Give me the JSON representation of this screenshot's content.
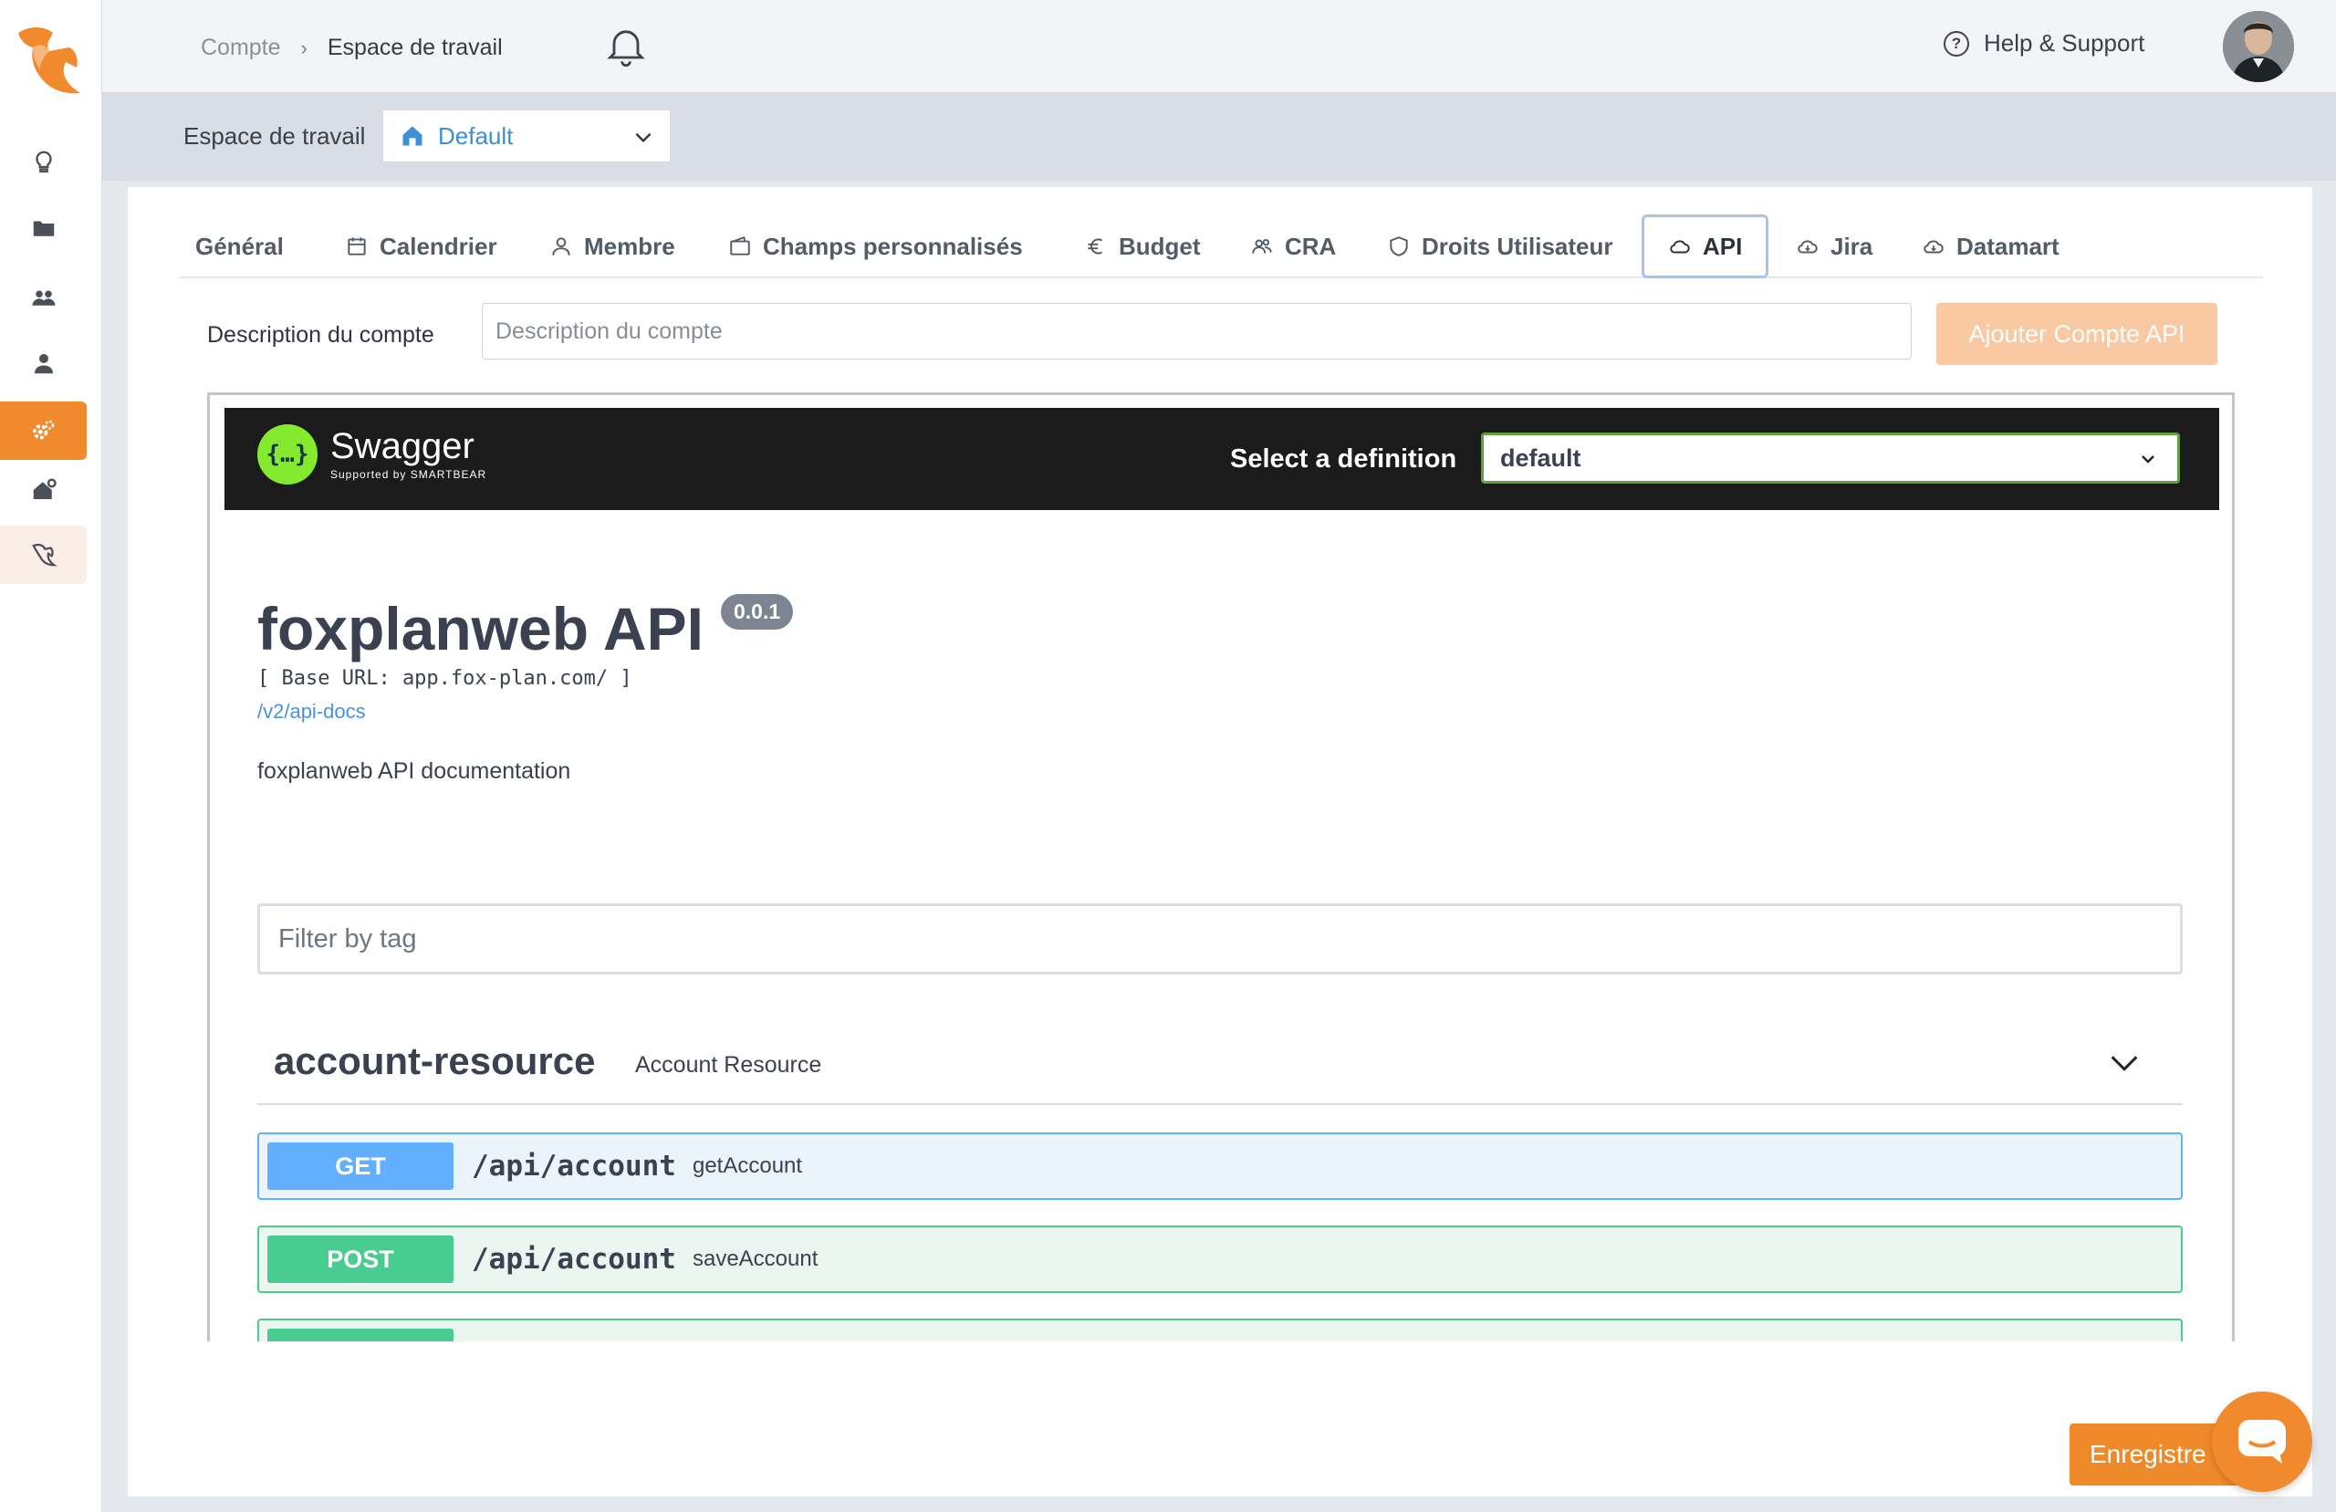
{
  "sidebar": {
    "items": [
      {
        "icon": "lightbulb-icon"
      },
      {
        "icon": "folder-icon"
      },
      {
        "icon": "team-icon"
      },
      {
        "icon": "user-icon"
      },
      {
        "icon": "gear-icon",
        "active": true
      },
      {
        "icon": "home-settings-icon"
      },
      {
        "icon": "fox-icon"
      }
    ],
    "accent_color": "#f08a2c"
  },
  "topbar": {
    "breadcrumb": [
      "Compte",
      "Espace de travail"
    ],
    "breadcrumb_sep": "›",
    "help_label": "Help & Support",
    "help_glyph": "?"
  },
  "workspace": {
    "label": "Espace de travail",
    "selected": "Default"
  },
  "tabs": [
    {
      "label": "Général",
      "icon": null
    },
    {
      "label": "Calendrier",
      "icon": "calendar-icon"
    },
    {
      "label": "Membre",
      "icon": "user-icon"
    },
    {
      "label": "Champs personnalisés",
      "icon": "wallet-icon"
    },
    {
      "label": "Budget",
      "icon": "euro-icon"
    },
    {
      "label": "CRA",
      "icon": "people-icon"
    },
    {
      "label": "Droits Utilisateur",
      "icon": "shield-icon"
    },
    {
      "label": "API",
      "icon": "cloud-icon",
      "active": true
    },
    {
      "label": "Jira",
      "icon": "cloud-sync-icon"
    },
    {
      "label": "Datamart",
      "icon": "cloud-sync-icon"
    }
  ],
  "account_form": {
    "label": "Description du compte",
    "placeholder": "Description du compte",
    "add_button": "Ajouter Compte API"
  },
  "swagger": {
    "logo_glyph": "{…}",
    "brand": "Swagger",
    "supported_by": "Supported by SMARTBEAR",
    "select_definition_label": "Select a definition",
    "definition_selected": "default",
    "api_title": "foxplanweb API",
    "version": "0.0.1",
    "base_url": "[ Base URL: app.fox-plan.com/ ]",
    "docs_link": "/v2/api-docs",
    "description": "foxplanweb API documentation",
    "filter_placeholder": "Filter by tag",
    "tag": {
      "name": "account-resource",
      "description": "Account Resource"
    },
    "operations": [
      {
        "method": "GET",
        "path": "/api/account",
        "operation_id": "getAccount",
        "color": "#61affe"
      },
      {
        "method": "POST",
        "path": "/api/account",
        "operation_id": "saveAccount",
        "color": "#49cc90"
      }
    ]
  },
  "footer": {
    "save_button": "Enregistre"
  }
}
